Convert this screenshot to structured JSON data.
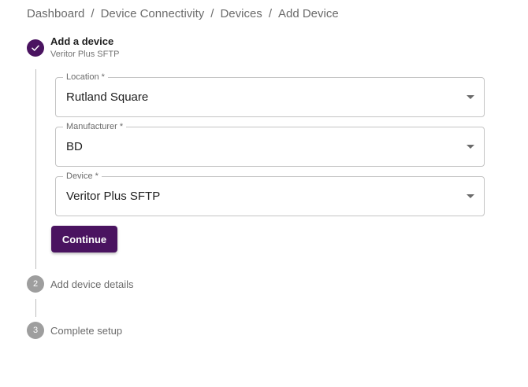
{
  "breadcrumb": {
    "items": [
      "Dashboard",
      "Device Connectivity",
      "Devices",
      "Add Device"
    ],
    "separator": "/"
  },
  "stepper": {
    "steps": [
      {
        "number": "1",
        "title": "Add a device",
        "subtitle": "Veritor Plus SFTP",
        "state": "completed"
      },
      {
        "number": "2",
        "title": "Add device details",
        "state": "pending"
      },
      {
        "number": "3",
        "title": "Complete setup",
        "state": "pending"
      }
    ]
  },
  "form": {
    "location": {
      "label": "Location *",
      "value": "Rutland Square"
    },
    "manufacturer": {
      "label": "Manufacturer *",
      "value": "BD"
    },
    "device": {
      "label": "Device *",
      "value": "Veritor Plus SFTP"
    },
    "continue_label": "Continue"
  },
  "colors": {
    "accent": "#4a1360",
    "inactive_step": "#9e9e9e"
  }
}
